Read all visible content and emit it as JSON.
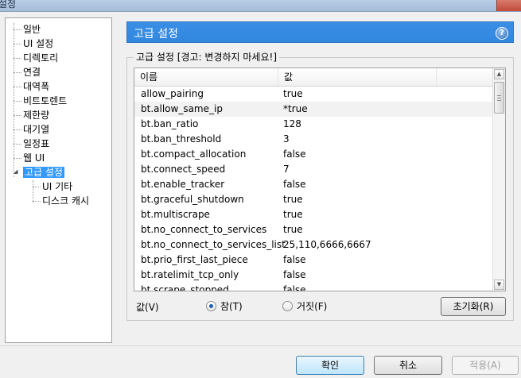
{
  "window": {
    "title": "설정"
  },
  "tree": {
    "items": [
      {
        "label": "일반"
      },
      {
        "label": "UI 설정"
      },
      {
        "label": "디렉토리"
      },
      {
        "label": "연결"
      },
      {
        "label": "대역폭"
      },
      {
        "label": "비트토렌트"
      },
      {
        "label": "제한량"
      },
      {
        "label": "대기열"
      },
      {
        "label": "일정표"
      },
      {
        "label": "웹 UI"
      },
      {
        "label": "고급 설정"
      }
    ],
    "children": [
      {
        "label": "UI 기타"
      },
      {
        "label": "디스크 캐시"
      }
    ]
  },
  "header": {
    "title": "고급 설정"
  },
  "group": {
    "legend": "고급 설정 [경고: 변경하지 마세요!]"
  },
  "list": {
    "columns": [
      "이름",
      "값"
    ],
    "rows": [
      {
        "name": "allow_pairing",
        "value": "true"
      },
      {
        "name": "bt.allow_same_ip",
        "value": "*true"
      },
      {
        "name": "bt.ban_ratio",
        "value": "128"
      },
      {
        "name": "bt.ban_threshold",
        "value": "3"
      },
      {
        "name": "bt.compact_allocation",
        "value": "false"
      },
      {
        "name": "bt.connect_speed",
        "value": "7"
      },
      {
        "name": "bt.enable_tracker",
        "value": "false"
      },
      {
        "name": "bt.graceful_shutdown",
        "value": "true"
      },
      {
        "name": "bt.multiscrape",
        "value": "true"
      },
      {
        "name": "bt.no_connect_to_services",
        "value": "true"
      },
      {
        "name": "bt.no_connect_to_services_list",
        "value": "25,110,6666,6667"
      },
      {
        "name": "bt.prio_first_last_piece",
        "value": "false"
      },
      {
        "name": "bt.ratelimit_tcp_only",
        "value": "false"
      },
      {
        "name": "bt.scrape_stopped",
        "value": "false"
      }
    ]
  },
  "value_editor": {
    "label": "값(V)",
    "true_label": "참(T)",
    "false_label": "거짓(F)",
    "reset_label": "초기화(R)"
  },
  "footer": {
    "ok_label": "확인",
    "cancel_label": "취소",
    "apply_label": "적용(A)"
  },
  "colors": {
    "header": "#3a8ee6",
    "selection": "#3399ff"
  }
}
